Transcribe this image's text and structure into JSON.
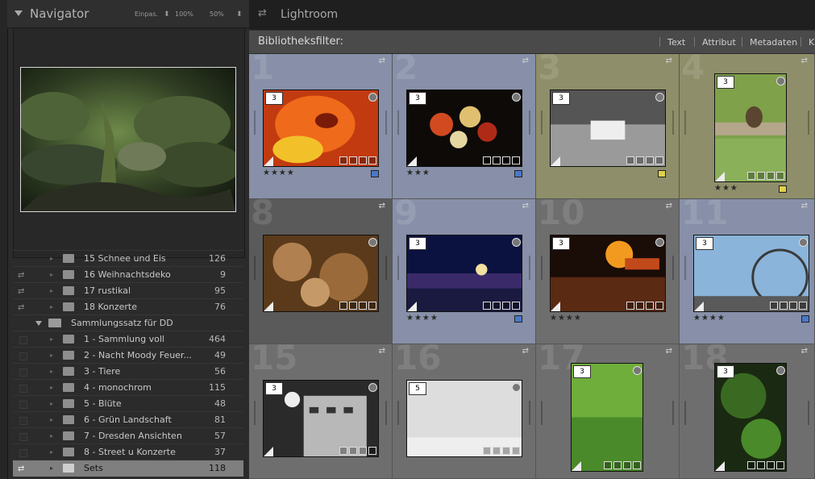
{
  "navigator": {
    "title": "Navigator",
    "options": [
      "Einpas.",
      "100%",
      "50%"
    ]
  },
  "collections": [
    {
      "label": "15 Schnee und Eis",
      "count": "126",
      "indent": "item"
    },
    {
      "label": "16 Weihnachtsdeko",
      "count": "9",
      "indent": "item"
    },
    {
      "label": "17 rustikal",
      "count": "95",
      "indent": "item"
    },
    {
      "label": "18 Konzerte",
      "count": "76",
      "indent": "item"
    },
    {
      "label": "Sammlungssatz für DD",
      "count": "",
      "indent": "set"
    },
    {
      "label": "1 - Sammlung voll",
      "count": "464",
      "indent": "item"
    },
    {
      "label": "2 - Nacht Moody Feuer...",
      "count": "49",
      "indent": "item"
    },
    {
      "label": "3 - Tiere",
      "count": "56",
      "indent": "item"
    },
    {
      "label": "4 - monochrom",
      "count": "115",
      "indent": "item"
    },
    {
      "label": "5 - Blüte",
      "count": "48",
      "indent": "item"
    },
    {
      "label": "6 - Grün Landschaft",
      "count": "81",
      "indent": "item"
    },
    {
      "label": "7 - Dresden Ansichten",
      "count": "57",
      "indent": "item"
    },
    {
      "label": "8 - Street u Konzerte",
      "count": "37",
      "indent": "item"
    },
    {
      "label": "Sets",
      "count": "118",
      "indent": "item",
      "selected": true
    }
  ],
  "header": {
    "title": "Lightroom",
    "swap_icon": "swap-arrows-icon"
  },
  "filter_bar": {
    "label": "Bibliotheksfilter:",
    "tabs": [
      "Text",
      "Attribut",
      "Metadaten",
      "K"
    ]
  },
  "grid_cells": [
    {
      "num": "1",
      "stack": "3",
      "stars": "★★★★",
      "label_color": "#4a78c8",
      "bg": "#8790a8",
      "thumb": "poppy"
    },
    {
      "num": "2",
      "stack": "3",
      "stars": "★★★",
      "label_color": "#4a78c8",
      "bg": "#8790a8",
      "thumb": "bouquet"
    },
    {
      "num": "3",
      "stack": "3",
      "stars": "",
      "label_color": "#e0d24a",
      "bg": "#8e8e6a",
      "thumb": "bridge"
    },
    {
      "num": "4",
      "stack": "3",
      "stars": "★★★",
      "label_color": "#e0d24a",
      "bg": "#8e8e6a",
      "thumb": "bird"
    },
    {
      "num": "8",
      "stack": "",
      "stars": "",
      "label_color": "",
      "bg": "#5a5a5a",
      "thumb": "texture"
    },
    {
      "num": "9",
      "stack": "3",
      "stars": "★★★★",
      "label_color": "#4a78c8",
      "bg": "#8790a8",
      "thumb": "citynight"
    },
    {
      "num": "10",
      "stack": "3",
      "stars": "★★★★",
      "label_color": "",
      "bg": "#6e6e6e",
      "thumb": "fire"
    },
    {
      "num": "11",
      "stack": "3",
      "stars": "★★★★",
      "label_color": "#4a78c8",
      "bg": "#8790a8",
      "thumb": "ferris"
    },
    {
      "num": "15",
      "stack": "3",
      "stars": "",
      "label_color": "",
      "bg": "#6e6e6e",
      "thumb": "building"
    },
    {
      "num": "16",
      "stack": "5",
      "stars": "",
      "label_color": "",
      "bg": "#6e6e6e",
      "thumb": "butterfly"
    },
    {
      "num": "17",
      "stack": "3",
      "stars": "",
      "label_color": "",
      "bg": "#6e6e6e",
      "thumb": "grass"
    },
    {
      "num": "18",
      "stack": "3",
      "stars": "",
      "label_color": "",
      "bg": "#6e6e6e",
      "thumb": "fern"
    }
  ]
}
